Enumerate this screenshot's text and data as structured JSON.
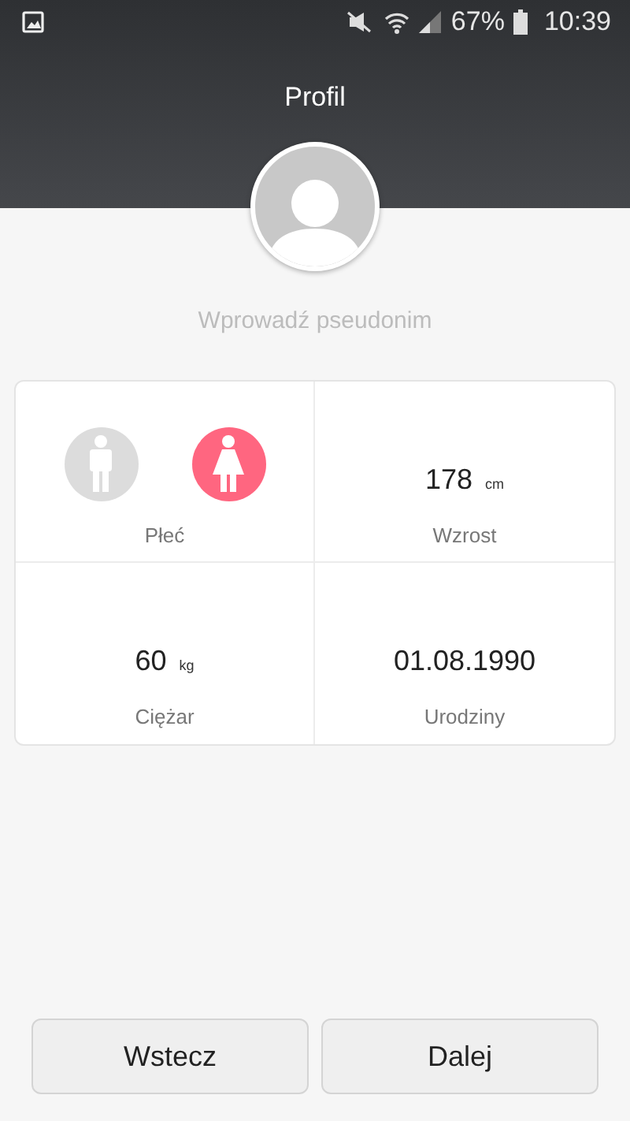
{
  "status_bar": {
    "battery": "67%",
    "time": "10:39"
  },
  "header": {
    "title": "Profil"
  },
  "nickname": {
    "placeholder": "Wprowadź pseudonim"
  },
  "rows": [
    {
      "cells": [
        {
          "kind": "gender",
          "label": "Płeć",
          "options": [
            {
              "kind": "male",
              "selected": false
            },
            {
              "kind": "female",
              "selected": true
            }
          ]
        },
        {
          "kind": "value",
          "value": "178",
          "unit": "cm",
          "label": "Wzrost"
        }
      ]
    },
    {
      "cells": [
        {
          "kind": "value",
          "value": "60",
          "unit": "kg",
          "label": "Ciężar"
        },
        {
          "kind": "value",
          "value": "01.08.1990",
          "label": "Urodziny"
        }
      ]
    }
  ],
  "buttons": [
    "Wstecz",
    "Dalej"
  ]
}
